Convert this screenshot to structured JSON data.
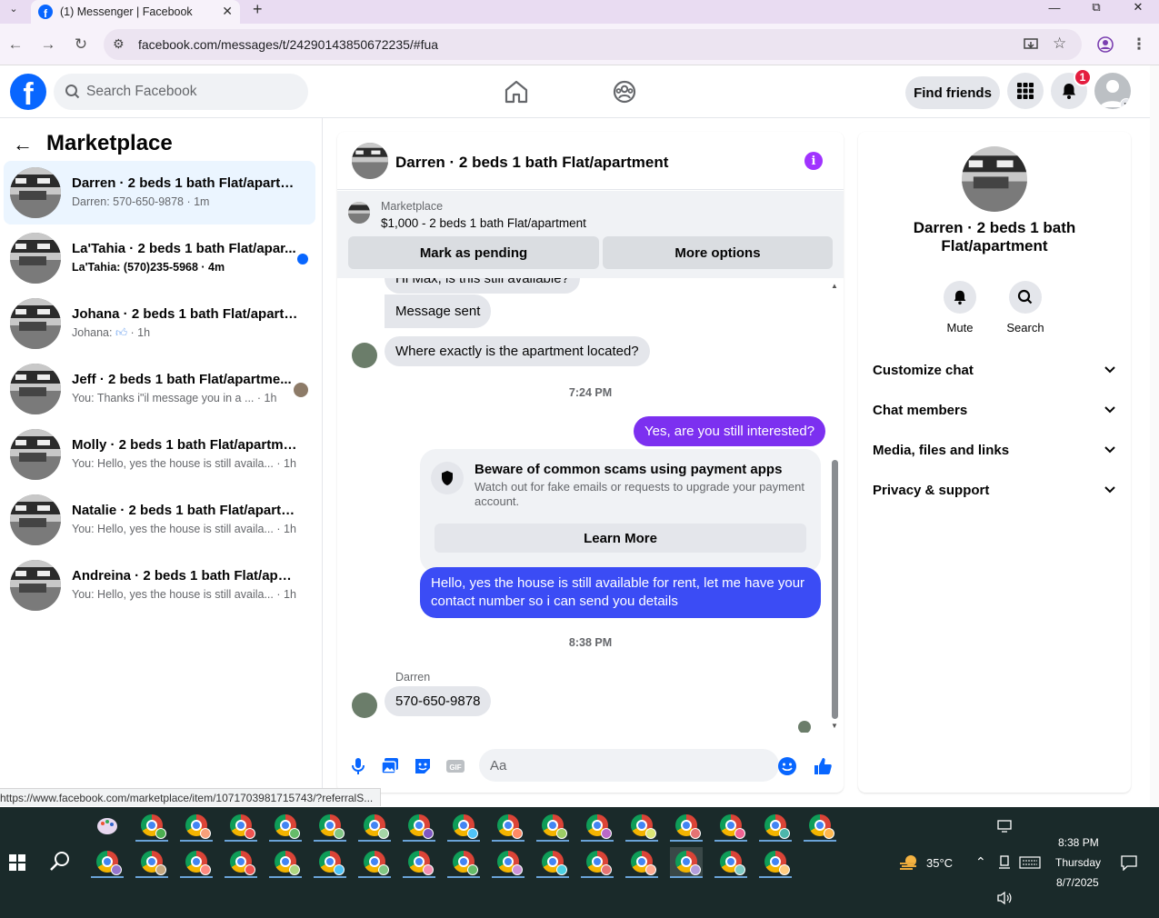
{
  "browser": {
    "tab_title": "(1) Messenger | Facebook",
    "url": "facebook.com/messages/t/24290143850672235/#fua",
    "status_url": "https://www.facebook.com/marketplace/item/1071703981715743/?referralS..."
  },
  "fb": {
    "search_placeholder": "Search Facebook",
    "find_friends": "Find friends",
    "notif_count": "1"
  },
  "sidebar": {
    "title": "Marketplace",
    "chats": [
      {
        "name": "Darren · 2 beds 1 bath Flat/apartm...",
        "snippet": "Darren: 570-650-9878 · 1m",
        "active": true,
        "unread": false
      },
      {
        "name": "La'Tahia · 2 beds 1 bath Flat/apar...",
        "snippet": "La'Tahia: (570)235-5968 · 4m",
        "active": false,
        "unread": true
      },
      {
        "name": "Johana · 2 beds 1 bath Flat/apartm...",
        "snippet_prefix": "Johana:",
        "snippet_suffix": "· 1h",
        "active": false,
        "unread": false
      },
      {
        "name": "Jeff · 2 beds 1 bath Flat/apartme...",
        "snippet": "You: Thanks i\"il message you in a ...  · 1h",
        "active": false,
        "unread": false
      },
      {
        "name": "Molly · 2 beds 1 bath Flat/apartment",
        "snippet": "You: Hello, yes the house is still availa... · 1h",
        "active": false,
        "unread": false
      },
      {
        "name": "Natalie · 2 beds 1 bath Flat/apartm...",
        "snippet": "You: Hello, yes the house is still availa... · 1h",
        "active": false,
        "unread": false
      },
      {
        "name": "Andreina · 2 beds 1 bath Flat/apart...",
        "snippet": "You: Hello, yes the house is still availa... · 1h",
        "active": false,
        "unread": false
      }
    ]
  },
  "conversation": {
    "title": "Darren · 2 beds 1 bath Flat/apartment",
    "marketplace_label": "Marketplace",
    "listing": "$1,000 - 2 beds 1 bath Flat/apartment",
    "mark_pending": "Mark as pending",
    "more_options": "More options",
    "messages": {
      "cut_top": "Hi Max, is this still available?",
      "sent_notice": "Message sent",
      "question": "Where exactly is the apartment located?",
      "time1": "7:24 PM",
      "reply1": "Yes, are you still interested?",
      "scam_title": "Beware of common scams using payment apps",
      "scam_body": "Watch out for fake emails or requests to upgrade your payment account.",
      "learn_more": "Learn More",
      "reply2": "Hello, yes the house is still available for rent, let me have your contact number so i can send you details",
      "time2": "8:38 PM",
      "sender": "Darren",
      "phone": "570-650-9878"
    },
    "composer_placeholder": "Aa"
  },
  "info_panel": {
    "name": "Darren · 2 beds 1 bath Flat/apartment",
    "mute": "Mute",
    "search": "Search",
    "sections": [
      "Customize chat",
      "Chat members",
      "Media, files and links",
      "Privacy & support"
    ]
  },
  "taskbar": {
    "weather": "35°C",
    "time": "8:38 PM",
    "day": "Thursday",
    "date": "8/7/2025"
  },
  "colors": {
    "fb_blue": "#0866ff",
    "bubble_out": "#3b4cf5",
    "bubble_out_alt": "#7c30f0",
    "info_purple": "#a033ff"
  }
}
